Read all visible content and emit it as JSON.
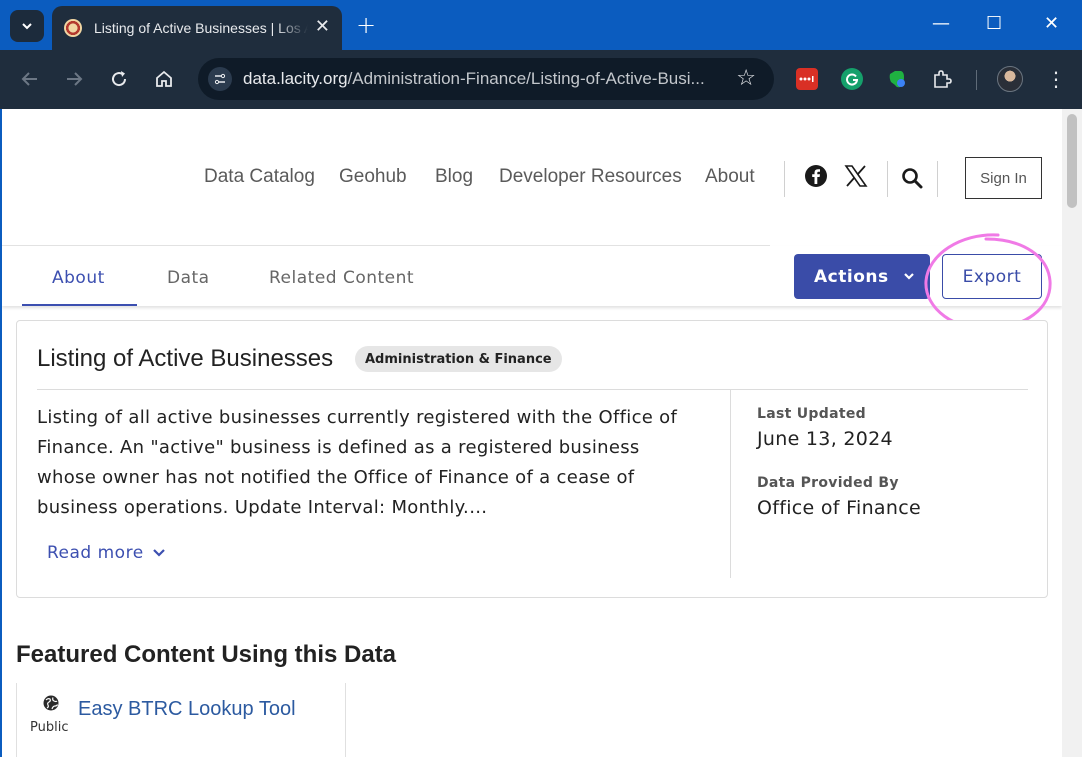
{
  "browser": {
    "tab_title": "Listing of Active Businesses | Los Angeles - Open Data Portal",
    "url_host": "data.lacity.org",
    "url_path": "/Administration-Finance/Listing-of-Active-Busi...",
    "new_tab_label": "+",
    "close_tab_glyph": "✕",
    "minimize_glyph": "—",
    "maximize_glyph": "☐",
    "close_window_glyph": "✕"
  },
  "site_nav": {
    "links": [
      "Data Catalog",
      "Geohub",
      "Blog",
      "Developer Resources",
      "About"
    ],
    "social_icons": [
      "facebook-icon",
      "x-icon"
    ],
    "sign_in_label": "Sign In"
  },
  "subnav": {
    "tabs": [
      "About",
      "Data",
      "Related Content"
    ],
    "active_tab": "About",
    "actions_label": "Actions",
    "export_label": "Export",
    "accent_color": "#3a4ca8",
    "annotation_color": "#f07ae6"
  },
  "dataset": {
    "title": "Listing of Active Businesses",
    "category_badge": "Administration & Finance",
    "description": "Listing of all active businesses currently registered with the Office of Finance. An \"active\" business is defined as a registered business whose owner has not notified the Office of Finance of a cease of business operations. Update Interval: Monthly.…",
    "read_more_label": "Read more",
    "last_updated_label": "Last Updated",
    "last_updated_value": "June 13, 2024",
    "provided_by_label": "Data Provided By",
    "provided_by_value": "Office of Finance"
  },
  "featured": {
    "heading": "Featured Content Using this Data",
    "items": [
      {
        "title": "Easy BTRC Lookup Tool",
        "visibility": "Public",
        "icon": "globe-icon"
      }
    ]
  }
}
